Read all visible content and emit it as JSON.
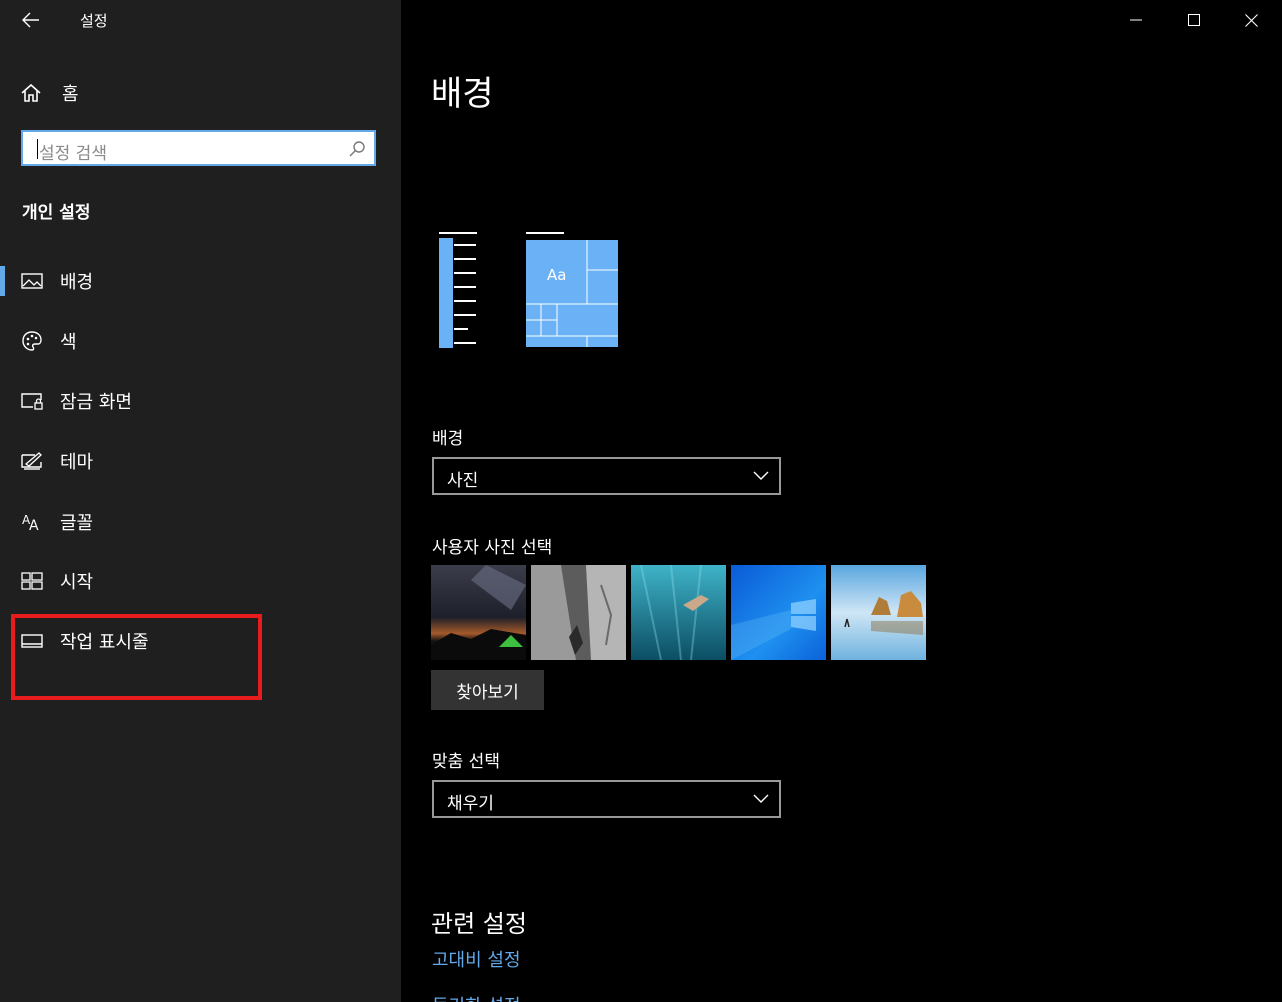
{
  "window": {
    "title": "설정"
  },
  "sidebar": {
    "home_label": "홈",
    "search_placeholder": "설정 검색",
    "section_title": "개인 설정",
    "items": [
      {
        "label": "배경",
        "icon": "picture-icon",
        "selected": true
      },
      {
        "label": "색",
        "icon": "palette-icon"
      },
      {
        "label": "잠금 화면",
        "icon": "lock-screen-icon"
      },
      {
        "label": "테마",
        "icon": "theme-icon"
      },
      {
        "label": "글꼴",
        "icon": "font-icon"
      },
      {
        "label": "시작",
        "icon": "start-icon"
      },
      {
        "label": "작업 표시줄",
        "icon": "taskbar-icon"
      }
    ]
  },
  "main": {
    "heading": "배경",
    "preview_text": "Aa",
    "background_label": "배경",
    "background_value": "사진",
    "choose_picture_label": "사용자 사진 선택",
    "browse_label": "찾아보기",
    "fit_label": "맞춤 선택",
    "fit_value": "채우기",
    "related_title": "관련 설정",
    "links": [
      "고대비 설정",
      "동기화 설정"
    ]
  },
  "colors": {
    "accent": "#63a8e8",
    "highlight": "#e81c1c",
    "sidebar_bg": "#1f1f1f"
  }
}
